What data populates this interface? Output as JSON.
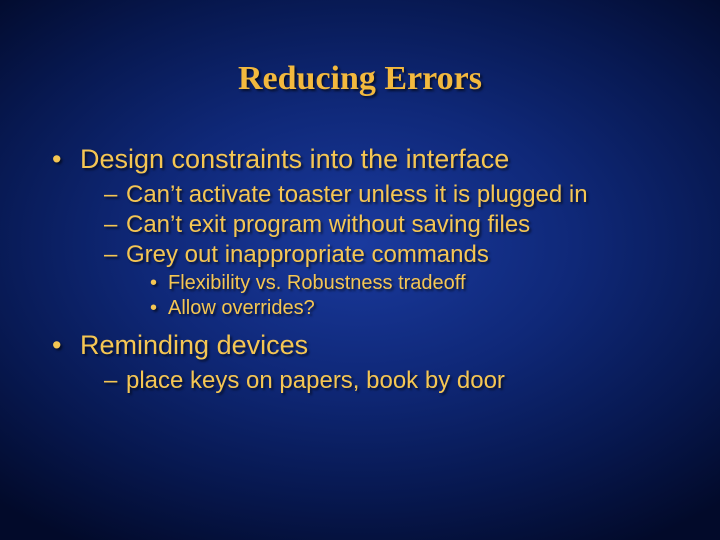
{
  "slide": {
    "title": "Reducing Errors",
    "bullets": {
      "b1": "Design constraints into the interface",
      "b1a": "Can’t activate toaster unless it is plugged in",
      "b1b": "Can’t exit program without saving files",
      "b1c": "Grey out inappropriate commands",
      "b1c1": "Flexibility vs. Robustness tradeoff",
      "b1c2": "Allow overrides?",
      "b2": "Reminding devices",
      "b2a": "place keys on papers, book by door"
    }
  }
}
